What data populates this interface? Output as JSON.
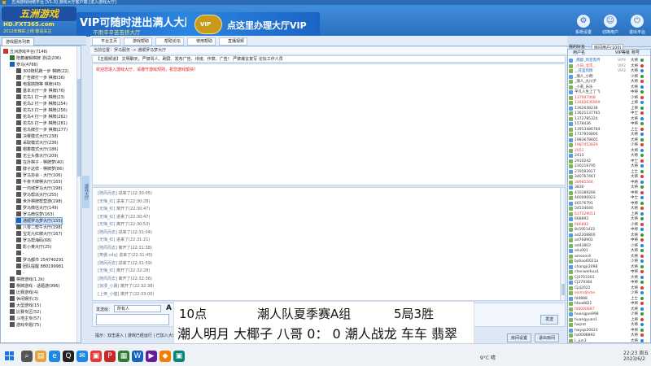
{
  "window": {
    "title": "五洲游戏网络平台 [V1.0] 游戏大厅客户端 [进入游戏大厅]"
  },
  "brand": {
    "logo_title": "五洲游戏",
    "logo_url": "HD.FXT365.com",
    "logo_slogan": "2012年精彩上线 敬请关注"
  },
  "banner": {
    "headline": "VIP可随时进出满人大厅",
    "subline": "不用辛辛苦苦挤大厅",
    "crest": "VIP",
    "cta": "点这里办理大厅VIP"
  },
  "top_actions": [
    {
      "label": "系统设置",
      "icon": "gear-icon",
      "glyph": "⚙"
    },
    {
      "label": "切换用户",
      "icon": "user-switch-icon",
      "glyph": "☺"
    },
    {
      "label": "退出平台",
      "icon": "power-icon",
      "glyph": "⏻"
    }
  ],
  "left_panel": {
    "tab": "游戏服务列表",
    "tree": [
      {
        "label": "五洲游戏平台(7146)",
        "level": 0,
        "color": "#c0392b"
      },
      {
        "label": "陪着编辑棋牌 测试(206)",
        "level": 1,
        "color": "#2e7d32"
      },
      {
        "label": "罗马(4766)",
        "level": 1,
        "color": "#1565c0"
      },
      {
        "label": "300随机跑一步 棋牌(22)",
        "level": 2,
        "color": "#555"
      },
      {
        "label": "广告牌打一步 棋牌(36)",
        "level": 2,
        "color": "#555"
      },
      {
        "label": "电报搞随等 棋牌(40)",
        "level": 2,
        "color": "#555"
      },
      {
        "label": "基本大厅一步 棋牌(76)",
        "level": 2,
        "color": "#555"
      },
      {
        "label": "花鸟1 打一步 棋牌(23)",
        "level": 2,
        "color": "#555"
      },
      {
        "label": "花鸟2 打一步 棋牌(254)",
        "level": 2,
        "color": "#555"
      },
      {
        "label": "花鸟3 打一步 棋牌(256)",
        "level": 2,
        "color": "#555"
      },
      {
        "label": "花鸟4 打一步 棋牌(262)",
        "level": 2,
        "color": "#555"
      },
      {
        "label": "花鸟5 打一步 棋牌(281)",
        "level": 2,
        "color": "#555"
      },
      {
        "label": "花鸟牌打一步 棋牌(277)",
        "level": 2,
        "color": "#555"
      },
      {
        "label": "决赛模式大厅(238)",
        "level": 2,
        "color": "#555"
      },
      {
        "label": "采取模式大厅(236)",
        "level": 2,
        "color": "#555"
      },
      {
        "label": "帽着模式大厅(186)",
        "level": 2,
        "color": "#555"
      },
      {
        "label": "无尘头像大厅(209)",
        "level": 2,
        "color": "#555"
      },
      {
        "label": "在外棋子 - 棋牌梦(40)",
        "level": 2,
        "color": "#555"
      },
      {
        "label": "脖子这样 - 棋牌梦(86)",
        "level": 2,
        "color": "#555"
      },
      {
        "label": "罗马协会 - 大厅(106)",
        "level": 2,
        "color": "#555"
      },
      {
        "label": "午夜卡牌棋大厅(165)",
        "level": 2,
        "color": "#555"
      },
      {
        "label": "一鸿城罗马大厅(198)",
        "level": 2,
        "color": "#555"
      },
      {
        "label": "罗马帮派大厅(255)",
        "level": 2,
        "color": "#555"
      },
      {
        "label": "世外棋牌帮营游(198)",
        "level": 2,
        "color": "#555"
      },
      {
        "label": "罗马微信大厅(149)",
        "level": 2,
        "color": "#555"
      },
      {
        "label": "罗马微信梦(163)",
        "level": 2,
        "color": "#555"
      },
      {
        "label": "通顺罗马梦大厅(155)",
        "level": 2,
        "color": "#1565c0",
        "selected": true
      },
      {
        "label": "八零二帮牛大厅(198)",
        "level": 2,
        "color": "#555"
      },
      {
        "label": "宝龙九红牌大厅(167)",
        "level": 2,
        "color": "#555"
      },
      {
        "label": "罗马帮海码(68)",
        "level": 2,
        "color": "#555"
      },
      {
        "label": "影小黄大厅(25)",
        "level": 2,
        "color": "#555"
      },
      {
        "label": "-",
        "level": 2,
        "color": "#555"
      },
      {
        "label": "罗马都市 254740291",
        "level": 2,
        "color": "#555"
      },
      {
        "label": "团队提醒 880199981",
        "level": 2,
        "color": "#555"
      },
      {
        "label": "-",
        "level": 2,
        "color": "#555"
      },
      {
        "label": "棋牌游戏(1.2k)",
        "level": 1,
        "color": "#555"
      },
      {
        "label": "棋牌游戏 - 话题游(996)",
        "level": 1,
        "color": "#555"
      },
      {
        "label": "比赛游戏(4)",
        "level": 1,
        "color": "#555"
      },
      {
        "label": "休闲娱乐(3)",
        "level": 1,
        "color": "#555"
      },
      {
        "label": "大型游戏(15)",
        "level": 1,
        "color": "#555"
      },
      {
        "label": "比赛专区(52)",
        "level": 1,
        "color": "#555"
      },
      {
        "label": "斗地主专(57)",
        "level": 1,
        "color": "#555"
      },
      {
        "label": "游戏专题(75)",
        "level": 1,
        "color": "#555"
      }
    ]
  },
  "splitter_label": "游戏大厅",
  "toolbar": {
    "buttons": [
      {
        "label": "平台主页",
        "color": "#e0a020"
      },
      {
        "label": "游戏帮助",
        "color": "#2e9d3a"
      },
      {
        "label": "帮助论坛",
        "color": "#1e88e5"
      },
      {
        "label": "使用帮助",
        "color": "#e53935"
      },
      {
        "label": "直播视频",
        "color": "#fb8c00"
      }
    ]
  },
  "breadcrumb": "当前位置：罗马服务 -> 通顺罗马梦大厅",
  "room": {
    "header": "【五题频道】 文明聊天，严禁骂人、刷屏、发布广告、诽谤、作弊、广告！ 严禁爆言复写 论坛工作人员",
    "notice": "欢迎您进入游戏大厅，请遵守游戏规则，祝您游戏愉快！"
  },
  "chat": {
    "lines": [
      {
        "name": "[随风而去]",
        "text": "进来了(22:30:05)"
      },
      {
        "name": "[无悔_红]",
        "text": "进来了(22:30:28)"
      },
      {
        "name": "[无悔_红]",
        "text": "离开了(22:30:47)"
      },
      {
        "name": "[无悔_红]",
        "text": "进来了(22:30:47)"
      },
      {
        "name": "[无悔_红]",
        "text": "离开了(22:30:53)"
      },
      {
        "name": "[随风而去]",
        "text": "进来了(22:31:04)"
      },
      {
        "name": "[无悔_红]",
        "text": "进来了(22:31:21)"
      },
      {
        "name": "[随风而去]",
        "text": "离开了(22:31:38)"
      },
      {
        "name": "[笑傲 cdq]",
        "text": "进来了(22:31:45)"
      },
      {
        "name": "[随风而去]",
        "text": "进来了(22:31:59)"
      },
      {
        "name": "[无悔_红]",
        "text": "离开了(22:32:28)"
      },
      {
        "name": "[随风而去]",
        "text": "离开了(22:32:36)"
      },
      {
        "name": "[浪漫_小屠]",
        "text": "离开了(22:32:38)"
      },
      {
        "name": "[上帝_小健]",
        "text": "离开了(22:33:00)"
      }
    ]
  },
  "input": {
    "target_label": "发送给：",
    "target_value": "所有人",
    "font_glyph": "A",
    "send_label": "发送"
  },
  "bottom": {
    "hint": "提示：双击进入 | 游戏已经运行 | 已加入大厅 | 请到聊天框与他人交谈",
    "btn_settings": "房间设置",
    "btn_exit": "退出房间"
  },
  "overlay": {
    "row1": [
      "10点",
      "潮人队夏季赛A组",
      "5局3胜"
    ],
    "row2": "潮人明月 大椰子 八哥 0： 0 潮人战龙 车车 翡翠"
  },
  "right_panel": {
    "tab_friends": "我的好友",
    "tab_room": "房间用户(100)",
    "columns": [
      "用户名",
      "VIP等级",
      "称号"
    ],
    "users": [
      {
        "name": "_殇醉_风花雪月",
        "vip": "VIP4",
        "rank": "大将",
        "color": "#1565c0"
      },
      {
        "name": "_小白_北京_",
        "vip": "VIP2",
        "rank": "大将",
        "color": "#e53935"
      },
      {
        "name": "__花里风情",
        "vip": "VIP2",
        "rank": "大将",
        "color": "#1565c0"
      },
      {
        "name": "_潮人_小明",
        "vip": "",
        "rank": "少将",
        "color": "#333"
      },
      {
        "name": "_潮人_九川子",
        "vip": "",
        "rank": "大将",
        "color": "#333"
      },
      {
        "name": "_小莉_乐乐",
        "vip": "",
        "rank": "大将",
        "color": "#333"
      },
      {
        "name": "平凡人生上了飞",
        "vip": "",
        "rank": "中将",
        "color": "#333"
      },
      {
        "name": "137997968",
        "vip": "",
        "rank": "少将",
        "color": "#e53935"
      },
      {
        "name": "13460636969",
        "vip": "",
        "rank": "上将",
        "color": "#e53935"
      },
      {
        "name": "1362638238",
        "vip": "",
        "rank": "上将",
        "color": "#333"
      },
      {
        "name": "13621137781",
        "vip": "",
        "rank": "中士",
        "color": "#333"
      },
      {
        "name": "1372785324",
        "vip": "",
        "rank": "大将",
        "color": "#333"
      },
      {
        "name": "1578436",
        "vip": "",
        "rank": "中将",
        "color": "#333"
      },
      {
        "name": "13953486784",
        "vip": "",
        "rank": "上士",
        "color": "#333"
      },
      {
        "name": "1737919806",
        "vip": "",
        "rank": "大将",
        "color": "#333"
      },
      {
        "name": "1983678605",
        "vip": "",
        "rank": "大将",
        "color": "#333"
      },
      {
        "name": "1987453929",
        "vip": "",
        "rank": "少将",
        "color": "#e53935"
      },
      {
        "name": "2051",
        "vip": "",
        "rank": "大将",
        "color": "#e53935"
      },
      {
        "name": "2433",
        "vip": "",
        "rank": "大将",
        "color": "#333"
      },
      {
        "name": "2910242",
        "vip": "",
        "rank": "中士",
        "color": "#333"
      },
      {
        "name": "230216795",
        "vip": "",
        "rank": "大将",
        "color": "#333"
      },
      {
        "name": "279593917",
        "vip": "",
        "rank": "上士",
        "color": "#333"
      },
      {
        "name": "340767467",
        "vip": "",
        "rank": "大将",
        "color": "#333"
      },
      {
        "name": "38985566",
        "vip": "",
        "rank": "中将",
        "color": "#e53935"
      },
      {
        "name": "3830",
        "vip": "",
        "rank": "大将",
        "color": "#333"
      },
      {
        "name": "410389266",
        "vip": "",
        "rank": "中将",
        "color": "#333"
      },
      {
        "name": "460090923",
        "vip": "",
        "rank": "中士",
        "color": "#333"
      },
      {
        "name": "46576791",
        "vip": "",
        "rank": "中将",
        "color": "#333"
      },
      {
        "name": "54534040",
        "vip": "",
        "rank": "大将",
        "color": "#333"
      },
      {
        "name": "637529011",
        "vip": "",
        "rank": "上将",
        "color": "#e53935"
      },
      {
        "name": "668892",
        "vip": "",
        "rank": "大将",
        "color": "#333"
      },
      {
        "name": "666892",
        "vip": "",
        "rank": "少将",
        "color": "#e53935"
      },
      {
        "name": "8s5951422",
        "vip": "",
        "rank": "中将",
        "color": "#333"
      },
      {
        "name": "ad2208800",
        "vip": "",
        "rank": "大将",
        "color": "#333"
      },
      {
        "name": "ad768901",
        "vip": "",
        "rank": "中将",
        "color": "#333"
      },
      {
        "name": "ad43802",
        "vip": "",
        "rank": "少将",
        "color": "#333"
      },
      {
        "name": "aliu001",
        "vip": "",
        "rank": "大将",
        "color": "#333"
      },
      {
        "name": "amesonli",
        "vip": "",
        "rank": "大将",
        "color": "#333"
      },
      {
        "name": "bjdiaol0021a",
        "vip": "",
        "rank": "少将",
        "color": "#333"
      },
      {
        "name": "changjr2098",
        "vip": "",
        "rank": "大将",
        "color": "#333"
      },
      {
        "name": "chenwelhua1",
        "vip": "",
        "rank": "中将",
        "color": "#333"
      },
      {
        "name": "Cj0703301",
        "vip": "",
        "rank": "大将",
        "color": "#333"
      },
      {
        "name": "CJ279384",
        "vip": "",
        "rank": "中将",
        "color": "#333"
      },
      {
        "name": "Cjzj2022",
        "vip": "",
        "rank": "大将",
        "color": "#333"
      },
      {
        "name": "exlmdjhme",
        "vip": "",
        "rank": "少将",
        "color": "#e53935"
      },
      {
        "name": "fd4888",
        "vip": "",
        "rank": "上士",
        "color": "#333"
      },
      {
        "name": "fdaa8821",
        "vip": "",
        "rank": "中将",
        "color": "#333"
      },
      {
        "name": "fd6000887",
        "vip": "",
        "rank": "大将",
        "color": "#e53935"
      },
      {
        "name": "huangpei998",
        "vip": "",
        "rank": "少将",
        "color": "#333"
      },
      {
        "name": "huangyuan1",
        "vip": "",
        "rank": "上将",
        "color": "#333"
      },
      {
        "name": "hwjrat",
        "vip": "",
        "rank": "大将",
        "color": "#333"
      },
      {
        "name": "hwyqs20021",
        "vip": "",
        "rank": "中将",
        "color": "#333"
      },
      {
        "name": "hz0098892",
        "vip": "",
        "rank": "大将",
        "color": "#333"
      },
      {
        "name": "L_jun3",
        "vip": "",
        "rank": "大将",
        "color": "#333"
      }
    ]
  },
  "taskbar": {
    "icons": [
      {
        "name": "search",
        "glyph": "⌕",
        "color": "#555"
      },
      {
        "name": "files",
        "glyph": "▤",
        "color": "#e6a23c"
      },
      {
        "name": "edge",
        "glyph": "e",
        "color": "#1e88e5"
      },
      {
        "name": "qq",
        "glyph": "Q",
        "color": "#222"
      },
      {
        "name": "mail",
        "glyph": "✉",
        "color": "#1e88e5"
      },
      {
        "name": "photos",
        "glyph": "▣",
        "color": "#e53935"
      },
      {
        "name": "pdf",
        "glyph": "P",
        "color": "#c62828"
      },
      {
        "name": "sheet",
        "glyph": "▦",
        "color": "#2e7d32"
      },
      {
        "name": "doc",
        "glyph": "W",
        "color": "#1565c0"
      },
      {
        "name": "media",
        "glyph": "▶",
        "color": "#6a1b9a"
      },
      {
        "name": "game",
        "glyph": "◆",
        "color": "#f57c00"
      },
      {
        "name": "client",
        "glyph": "▣",
        "color": "#00897b"
      }
    ],
    "weather": "9°C 晴",
    "time": "22:23 周五",
    "date": "2023/6/2"
  }
}
